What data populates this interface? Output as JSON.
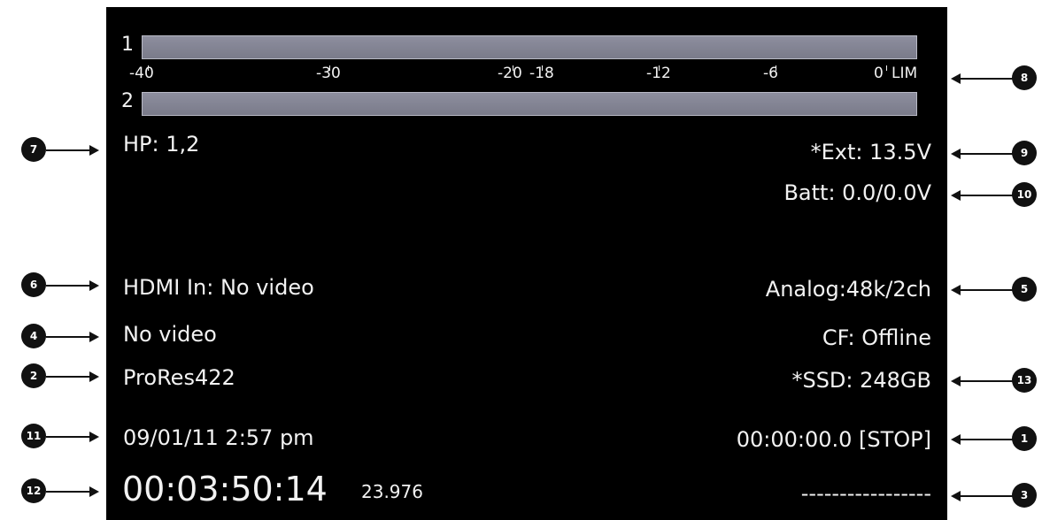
{
  "meters": {
    "channel1_label": "1",
    "channel2_label": "2",
    "scale": [
      "-40",
      "-30",
      "-20",
      "-18",
      "-12",
      "-6",
      "0"
    ],
    "lim_label": "LIM",
    "bar_color": "#8d8e9e"
  },
  "status": {
    "headphones": "HP: 1,2",
    "ext_power": "*Ext: 13.5V",
    "battery": "Batt: 0.0/0.0V",
    "hdmi_in": "HDMI In: No video",
    "audio_input": "Analog:48k/2ch",
    "video_status": "No video",
    "cf_status": "CF: Offline",
    "codec": "ProRes422",
    "ssd_status": "*SSD: 248GB",
    "datetime": "09/01/11 2:57 pm",
    "record_time": "00:00:00.0 [STOP]",
    "timecode": "00:03:50:14",
    "frame_rate": "23.976",
    "filename": "-----------------"
  },
  "callouts": [
    "1",
    "2",
    "3",
    "4",
    "5",
    "6",
    "7",
    "8",
    "9",
    "10",
    "11",
    "12",
    "13"
  ]
}
